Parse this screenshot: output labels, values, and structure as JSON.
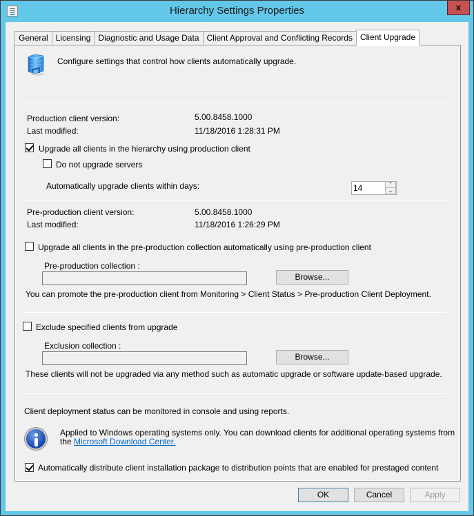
{
  "window": {
    "title": "Hierarchy Settings Properties",
    "close_label": "x"
  },
  "tabs": [
    {
      "label": "General",
      "active": false
    },
    {
      "label": "Licensing",
      "active": false
    },
    {
      "label": "Diagnostic and Usage Data",
      "active": false
    },
    {
      "label": "Client Approval and Conflicting Records",
      "active": false
    },
    {
      "label": "Client Upgrade",
      "active": true
    }
  ],
  "header": {
    "description": "Configure settings that control how clients automatically upgrade."
  },
  "production": {
    "version_label": "Production client version:",
    "version_value": "5.00.8458.1000",
    "modified_label": "Last modified:",
    "modified_value": "11/18/2016 1:28:31 PM",
    "upgrade_all": {
      "label": "Upgrade all clients in the hierarchy using production client",
      "checked": true
    },
    "no_servers": {
      "label": "Do not upgrade servers",
      "checked": false
    },
    "days_label": "Automatically upgrade clients within days:",
    "days_value": "14"
  },
  "preproduction": {
    "version_label": "Pre-production client version:",
    "version_value": "5.00.8458.1000",
    "modified_label": "Last modified:",
    "modified_value": "11/18/2016 1:26:29 PM",
    "upgrade_all": {
      "label": "Upgrade all clients in the pre-production collection automatically using pre-production client",
      "checked": false
    },
    "collection_label": "Pre-production collection :",
    "collection_value": "",
    "browse_label": "Browse...",
    "promote_note": "You can promote the pre-production client from Monitoring > Client Status > Pre-production Client Deployment."
  },
  "exclusion": {
    "exclude": {
      "label": "Exclude specified clients from upgrade",
      "checked": false
    },
    "collection_label": "Exclusion collection :",
    "collection_value": "",
    "browse_label": "Browse...",
    "note": "These clients will not be upgraded via any method such as automatic upgrade or software update-based upgrade."
  },
  "footer_info": {
    "monitor_note": "Client deployment status can be monitored in console and using reports.",
    "info_text_line1": "Applied to Windows operating systems only. You can download clients for additional operating systems from",
    "info_text_prefix": "the ",
    "info_link": "Microsoft Download Center.",
    "auto_distribute": {
      "label": "Automatically distribute client installation package to distribution points that are enabled for prestaged content",
      "checked": true
    }
  },
  "buttons": {
    "ok": "OK",
    "cancel": "Cancel",
    "apply": "Apply"
  }
}
